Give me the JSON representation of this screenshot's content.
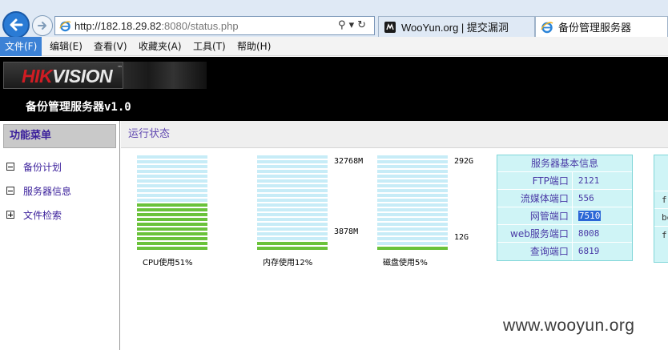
{
  "browser": {
    "url_host": "http://182.18.29.82",
    "url_rest": ":8080/status.php",
    "tabs": [
      {
        "label": "WooYun.org | 提交漏洞"
      },
      {
        "label": "备份管理服务器"
      }
    ],
    "menu": [
      "文件(F)",
      "编辑(E)",
      "查看(V)",
      "收藏夹(A)",
      "工具(T)",
      "帮助(H)"
    ]
  },
  "header": {
    "logo_hik": "HIK",
    "logo_vision": "VISION",
    "logo_tm": "™",
    "title": "备份管理服务器v1.0"
  },
  "sidebar": {
    "title": "功能菜单",
    "items": [
      {
        "label": "备份计划",
        "expander": "minus"
      },
      {
        "label": "服务器信息",
        "expander": "minus"
      },
      {
        "label": "文件检索",
        "expander": "plus"
      }
    ]
  },
  "main": {
    "title": "运行状态",
    "gauges": [
      {
        "label": "CPU使用51%",
        "percent": 51,
        "top_label": "",
        "bottom_label": ""
      },
      {
        "label": "内存使用12%",
        "percent": 12,
        "top_label": "32768M",
        "bottom_label": "3878M"
      },
      {
        "label": "磁盘使用5%",
        "percent": 5,
        "top_label": "292G",
        "bottom_label": "12G"
      }
    ],
    "server_info": {
      "title": "服务器基本信息",
      "rows": [
        {
          "key": "FTP端口",
          "value": "2121",
          "selected": false
        },
        {
          "key": "流媒体端口",
          "value": "556",
          "selected": false
        },
        {
          "key": "网管端口",
          "value": "7510",
          "selected": true
        },
        {
          "key": "web服务端口",
          "value": "8008",
          "selected": false
        },
        {
          "key": "查询端口",
          "value": "6819",
          "selected": false
        }
      ]
    },
    "partial_table": [
      "f:",
      "be",
      "f:"
    ]
  },
  "watermark": "www.wooyun.org",
  "colors": {
    "bar_used": "#6ac23a",
    "bar_free": "#c7ecf7",
    "table_bg": "#cff4f6",
    "link_text": "#3a1f9b",
    "header_bg": "#000000",
    "logo_red": "#d01c23"
  }
}
